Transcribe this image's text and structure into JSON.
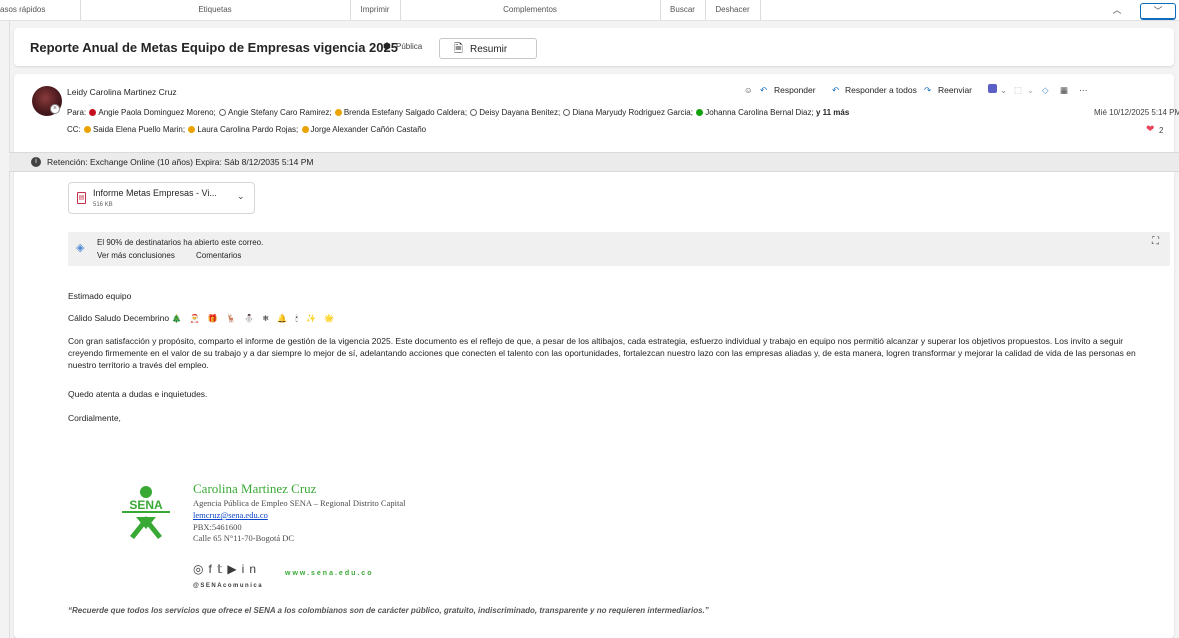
{
  "ribbon": {
    "groups": [
      "asos rápidos",
      "Etiquetas",
      "Imprimir",
      "Complementos",
      "Buscar",
      "Deshacer"
    ],
    "collapse_icon": "chevron-up-icon",
    "expand_icon": "chevron-down-icon"
  },
  "header": {
    "subject": "Reporte Anual de Metas  Equipo de Empresas vigencia 2025",
    "visibility": "Pública",
    "summarize_label": "Resumir"
  },
  "message": {
    "sender": "Leidy Carolina Martinez Cruz",
    "to_label": "Para:",
    "to": [
      {
        "name": "Angie Paola Dominguez Moreno;",
        "status": "busy"
      },
      {
        "name": "Angie Stefany Caro Ramirez;",
        "status": "off"
      },
      {
        "name": "Brenda Estefany Salgado Caldera;",
        "status": "away"
      },
      {
        "name": "Deisy Dayana Benitez;",
        "status": "off"
      },
      {
        "name": "Diana Maryudy Rodriguez Garcia;",
        "status": "off"
      },
      {
        "name": "Johanna Carolina Bernal Diaz;",
        "status": "avail"
      }
    ],
    "more_label": "y 11 más",
    "cc_label": "CC:",
    "cc": [
      {
        "name": "Saida Elena Puello Marin;",
        "status": "away"
      },
      {
        "name": "Laura Carolina Pardo Rojas;",
        "status": "away"
      },
      {
        "name": "Jorge Alexander Cañón Castaño",
        "status": "away"
      }
    ],
    "date": "Mié 10/12/2025 5:14 PM",
    "reactions_count": "2",
    "actions": {
      "reply": "Responder",
      "reply_all": "Responder a todos",
      "forward": "Reenviar"
    }
  },
  "retention": "Retención: Exchange Online (10 años) Expira: Sáb 8/12/2035 5:14 PM",
  "attachment": {
    "name": "Informe Metas Empresas - Vi...",
    "size": "516 KB"
  },
  "insight": {
    "text": "El 90% de destinatarios ha abierto este correo.",
    "link_more": "Ver más conclusiones",
    "link_comments": "Comentarios"
  },
  "body": {
    "greeting": "Estimado equipo",
    "salute": "Cálido Saludo Decembrino",
    "emojis": "🎄 🎅 🎁 🦌 ⛄ ❄ 🔔 🕯 ✨ 🌟",
    "paragraph": "Con gran satisfacción y propósito, comparto el informe de gestión de la vigencia 2025. Este documento es el reflejo de que, a pesar de los altibajos, cada estrategia, esfuerzo individual y trabajo en equipo nos permitió alcanzar y superar los objetivos propuestos. Los invito a seguir creyendo firmemente en el valor de su trabajo y a dar siempre lo mejor de sí, adelantando acciones que conecten el talento con las oportunidades, fortalezcan nuestro lazo con las empresas aliadas y, de esta manera, logren transformar y mejorar la calidad de vida de las personas en nuestro territorio a través del empleo.",
    "closing_note": "Quedo atenta a dudas e inquietudes.",
    "signoff": "Cordialmente,"
  },
  "signature": {
    "logo_text": "SENA",
    "name": "Carolina Martinez Cruz",
    "org": "Agencia Pública de Empleo SENA – Regional Distrito Capital",
    "email": "lemcruz@sena.edu.co",
    "phone": "PBX:5461600",
    "address": "Calle 65 N°11-70-Bogotá DC",
    "website": "www.sena.edu.co",
    "handle": "@SENAcomunica",
    "quote": "“Recuerde que todos los servicios que ofrece el SENA a los colombianos son de carácter público, gratuito, indiscriminado, transparente y no requieren intermediarios.”"
  },
  "colors": {
    "accent": "#0f6cbd",
    "sena_green": "#39a935",
    "busy": "#c50f1f",
    "away": "#eaa300",
    "available": "#13a10e"
  }
}
